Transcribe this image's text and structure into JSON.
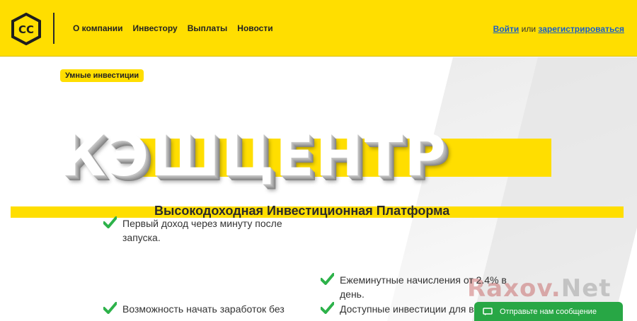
{
  "header": {
    "logo_text": "CC",
    "nav": [
      "О компании",
      "Инвестору",
      "Выплаты",
      "Новости"
    ],
    "login_label": "Войти",
    "or_label": "или",
    "register_label": "зарегистрироваться"
  },
  "hero": {
    "tag": "Умные инвестиции",
    "title": "КЭШЦЕНТР",
    "subtitle": "Высокодоходная Инвестиционная Платформа"
  },
  "features": [
    "Первый доход через минуту после запуска.",
    "Возможность начать заработок без",
    "Ежеминутные начисления от 2.4% в день.",
    "Доступные инвестиции для в"
  ],
  "watermark": {
    "part1": "Raxov.",
    "part2": "Net"
  },
  "chat": {
    "label": "Отправьте нам сообщение"
  },
  "colors": {
    "brand_yellow": "#ffde00",
    "check_green": "#2db24a",
    "chat_green": "#28a745",
    "link_blue": "#1a5fc7"
  }
}
